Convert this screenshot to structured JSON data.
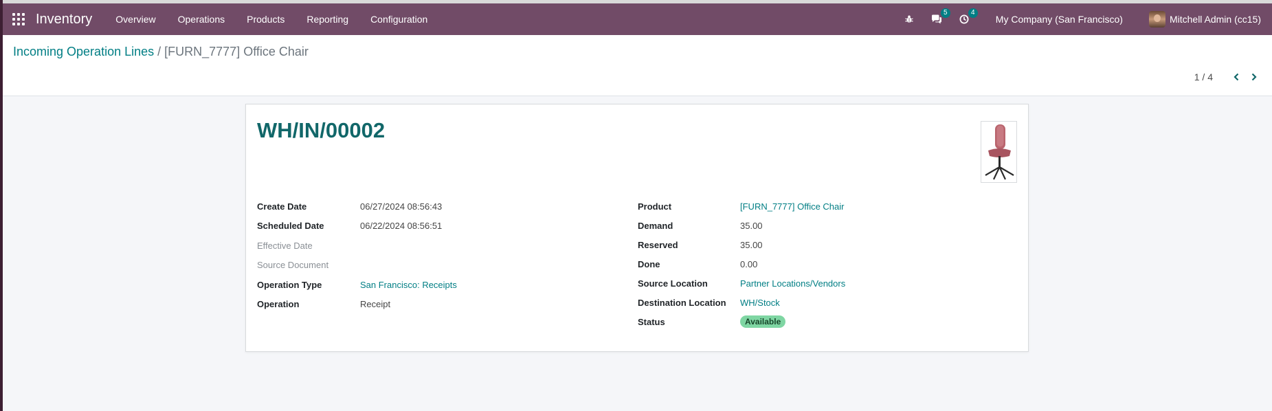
{
  "navbar": {
    "app_name": "Inventory",
    "menu": [
      "Overview",
      "Operations",
      "Products",
      "Reporting",
      "Configuration"
    ],
    "messages_badge": "5",
    "activities_badge": "4",
    "company": "My Company (San Francisco)",
    "user": "Mitchell Admin (cc15)"
  },
  "breadcrumb": {
    "parent": "Incoming Operation Lines",
    "separator": " / ",
    "current": "[FURN_7777] Office Chair"
  },
  "pager": {
    "value": "1 / 4"
  },
  "record": {
    "reference": "WH/IN/00002",
    "left_fields": [
      {
        "label": "Create Date",
        "value": "06/27/2024 08:56:43"
      },
      {
        "label": "Scheduled Date",
        "value": "06/22/2024 08:56:51"
      },
      {
        "label": "Effective Date",
        "value": ""
      },
      {
        "label": "Source Document",
        "value": ""
      },
      {
        "label": "Operation Type",
        "value": "San Francisco: Receipts"
      },
      {
        "label": "Operation",
        "value": "Receipt"
      }
    ],
    "right_fields": [
      {
        "label": "Product",
        "value": "[FURN_7777] Office Chair"
      },
      {
        "label": "Demand",
        "value": "35.00"
      },
      {
        "label": "Reserved",
        "value": "35.00"
      },
      {
        "label": "Done",
        "value": "0.00"
      },
      {
        "label": "Source Location",
        "value": "Partner Locations/Vendors"
      },
      {
        "label": "Destination Location",
        "value": "WH/Stock"
      },
      {
        "label": "Status",
        "value": "Available"
      }
    ]
  },
  "colors": {
    "navbar": "#714b67",
    "link": "#017e84",
    "title": "#116769",
    "status_available": "#7fd6a3"
  },
  "icons": {
    "apps": "apps-grid-icon",
    "debug": "bug-icon",
    "messages": "chat-icon",
    "activities": "clock-icon",
    "pager_prev": "chevron-left-icon",
    "pager_next": "chevron-right-icon"
  }
}
